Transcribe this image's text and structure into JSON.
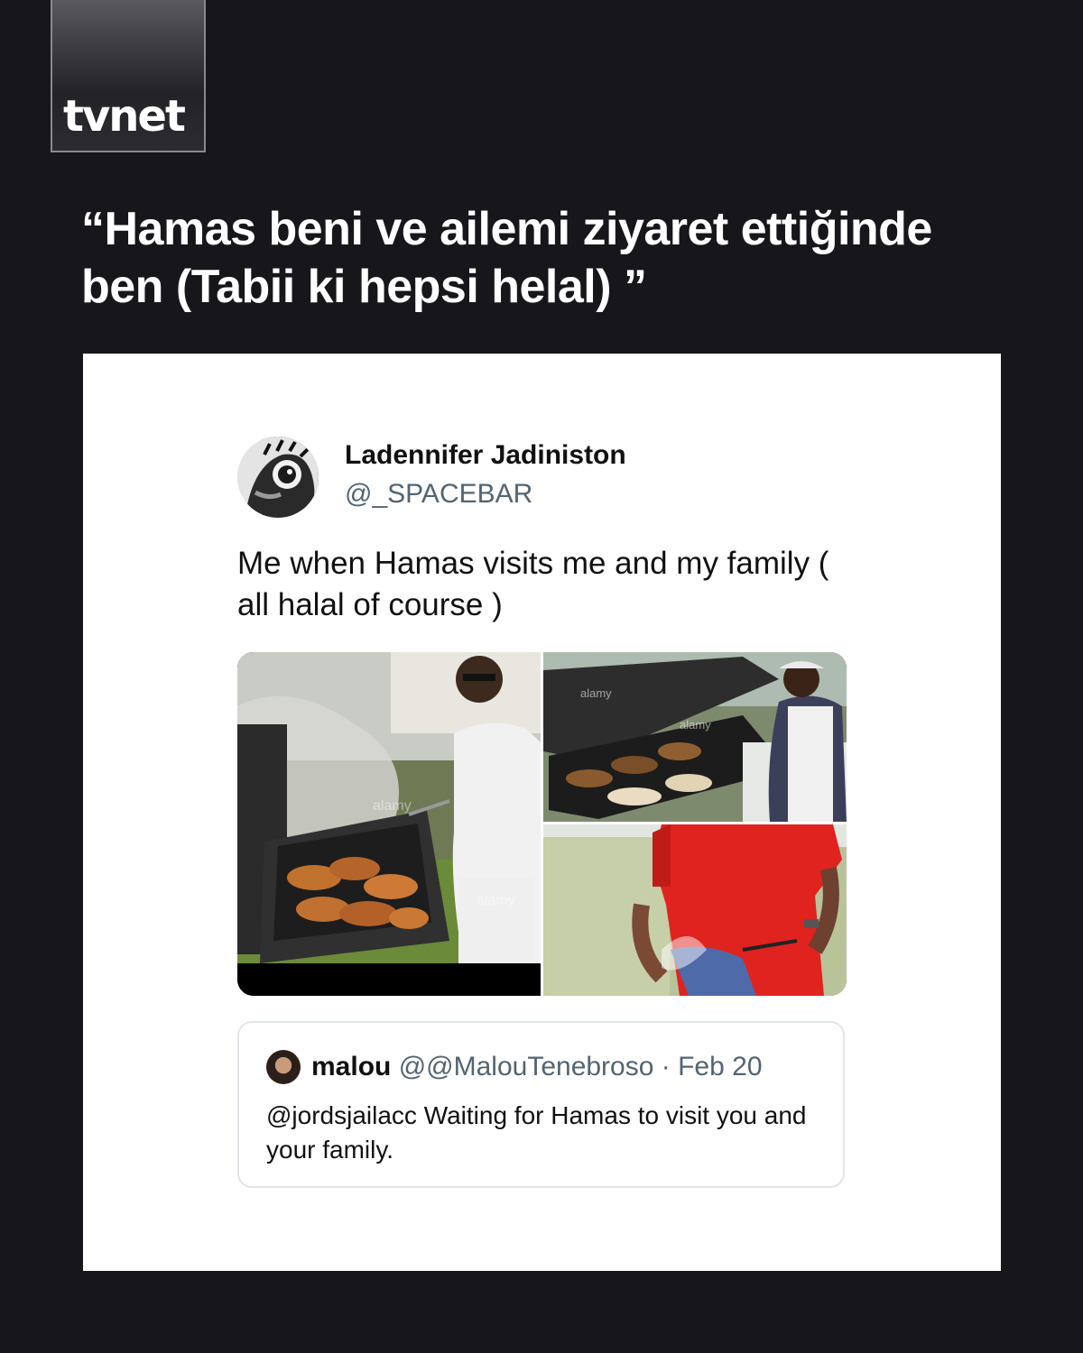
{
  "logo": {
    "text": "tvnet"
  },
  "headline": "“Hamas beni ve ailemi ziyaret ettiğinde ben (Tabii ki hepsi helal) ”",
  "tweet": {
    "display_name": "Ladennifer Jadiniston",
    "handle": "@_SPACEBAR",
    "text": "Me when Hamas visits me and my family ( all halal of course )",
    "media": {
      "photo_count": 3,
      "watermark": "alamy"
    },
    "quoted": {
      "display_name": "malou",
      "handle": "@@MalouTenebroso",
      "separator": "·",
      "date": "Feb 20",
      "text": "@jordsjailacc Waiting for Hamas to visit you and your family."
    }
  },
  "colors": {
    "background": "#17161b",
    "card": "#ffffff",
    "secondary_text": "#536471",
    "apron_red": "#e0231f"
  }
}
